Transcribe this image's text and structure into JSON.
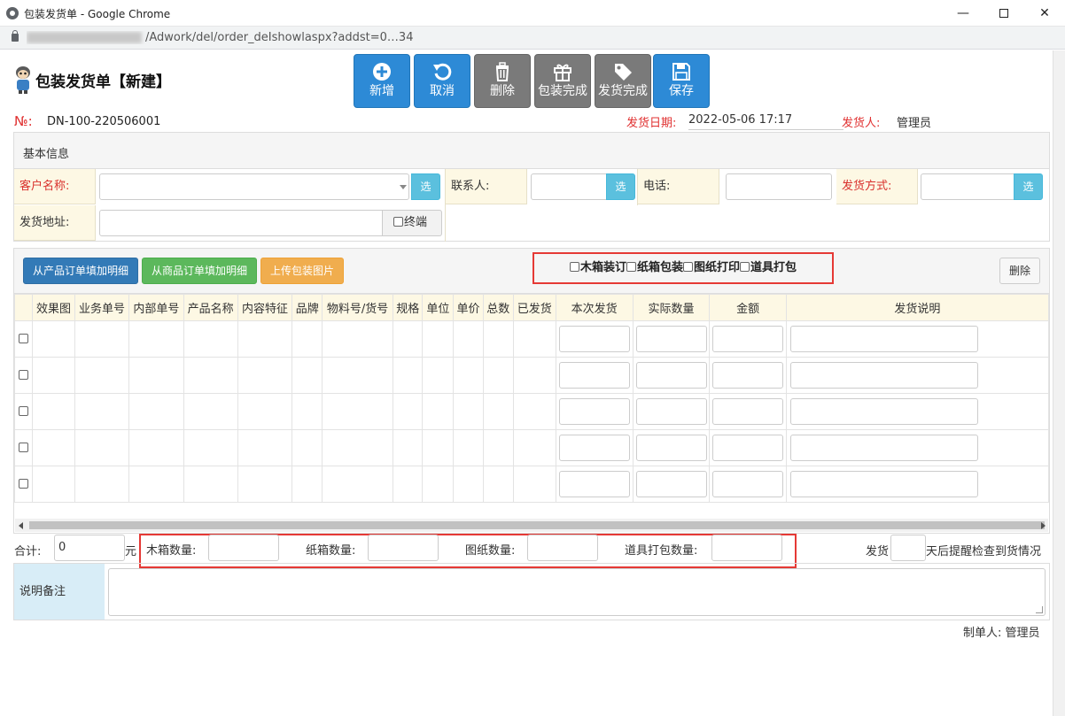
{
  "window": {
    "title": "包装发货单 - Google Chrome",
    "url_suffix": "/Adwork/del/order_deIshowlaspx?addst=0…34",
    "min_glyph": "—",
    "close_glyph": "✕"
  },
  "header": {
    "title": "包装发货单【新建】",
    "toolbar": [
      {
        "label": "新增",
        "icon": "plus-circle-icon",
        "style": "blue"
      },
      {
        "label": "取消",
        "icon": "undo-icon",
        "style": "blue"
      },
      {
        "label": "删除",
        "icon": "trash-icon",
        "style": "gray"
      },
      {
        "label": "包装完成",
        "icon": "gift-icon",
        "style": "gray"
      },
      {
        "label": "发货完成",
        "icon": "tag-icon",
        "style": "gray"
      },
      {
        "label": "保存",
        "icon": "save-icon",
        "style": "blue"
      }
    ]
  },
  "order": {
    "no_label": "№:",
    "no_value": "DN-100-220506001",
    "date_label": "发货日期:",
    "date_value": "2022-05-06 17:17",
    "sender_label": "发货人:",
    "sender_value": "管理员"
  },
  "basic_info": {
    "title": "基本信息",
    "customer_label": "客户名称:",
    "contact_label": "联系人:",
    "phone_label": "电话:",
    "ship_method_label": "发货方式:",
    "address_label": "发货地址:",
    "pick_label": "选",
    "terminal_label": "终端"
  },
  "detail": {
    "buttons": {
      "from_product_order": "从产品订单填加明细",
      "from_goods_order": "从商品订单填加明细",
      "upload_images": "上传包装图片",
      "delete": "删除"
    },
    "packing_options": [
      "木箱装订",
      "纸箱包装",
      "图纸打印",
      "道具打包"
    ],
    "columns": [
      "效果图",
      "业务单号",
      "内部单号",
      "产品名称",
      "内容特征",
      "品牌",
      "物料号/货号",
      "规格",
      "单位",
      "单价",
      "总数",
      "已发货",
      "本次发货",
      "实际数量",
      "金额",
      "发货说明"
    ],
    "row_count": 5
  },
  "summary": {
    "total_label": "合计:",
    "total_value": "0",
    "unit": "元",
    "wood_box_label": "木箱数量:",
    "carton_label": "纸箱数量:",
    "drawing_label": "图纸数量:",
    "prop_label": "道具打包数量:",
    "remind_prefix": "发货",
    "remind_suffix": "天后提醒检查到货情况"
  },
  "remark": {
    "label": "说明备注"
  },
  "footer": {
    "maker_label": "制单人:",
    "maker_value": "管理员"
  }
}
